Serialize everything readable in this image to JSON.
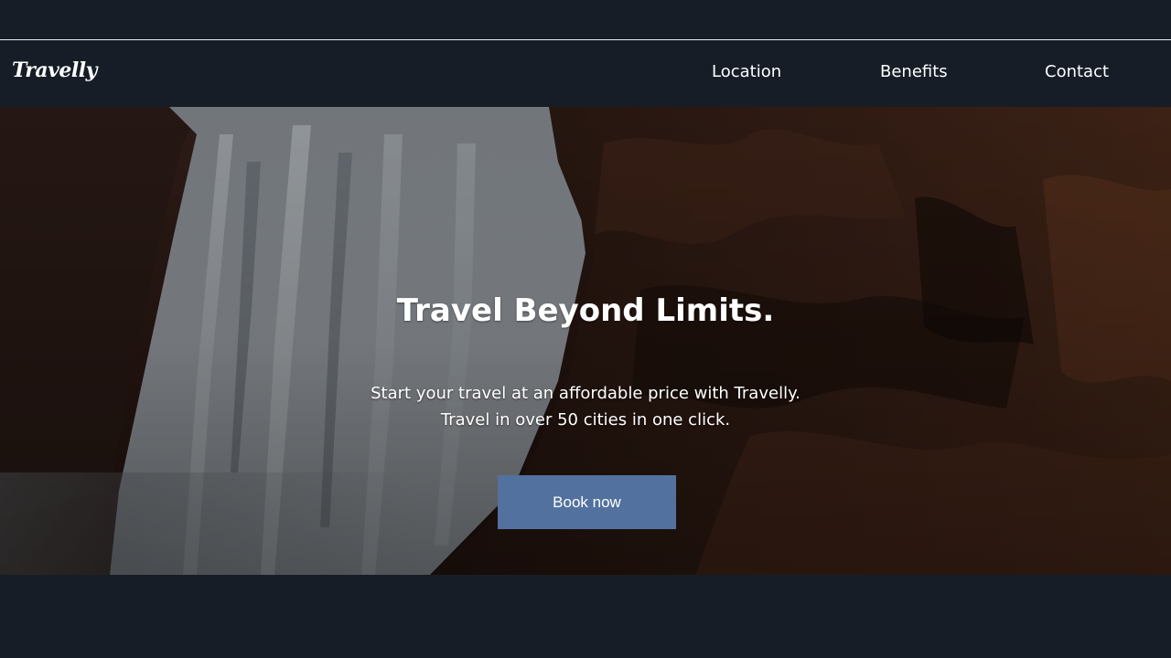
{
  "brand": {
    "logo": "Travelly"
  },
  "nav": {
    "location": "Location",
    "benefits": "Benefits",
    "contact": "Contact"
  },
  "hero": {
    "title": "Travel Beyond Limits.",
    "line1": "Start your travel at an affordable price with Travelly.",
    "line2": "Travel in over 50 cities in one click.",
    "button": "Book now"
  },
  "colors": {
    "background": "#161d27",
    "button": "#52719e",
    "text": "#ffffff"
  }
}
